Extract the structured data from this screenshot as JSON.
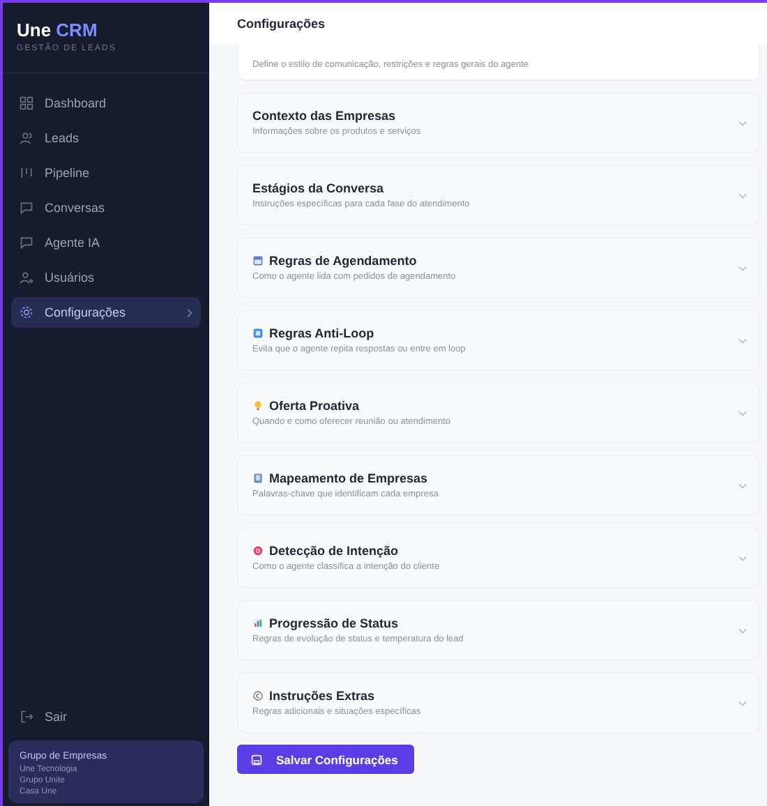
{
  "brand": {
    "name": "Une",
    "accent": "CRM",
    "tagline": "GESTÃO DE LEADS"
  },
  "nav": [
    {
      "label": "Dashboard",
      "kind": "grid",
      "selected": false
    },
    {
      "label": "Leads",
      "kind": "users",
      "selected": false
    },
    {
      "label": "Pipeline",
      "kind": "pipeline",
      "selected": false
    },
    {
      "label": "Conversas",
      "kind": "chat",
      "selected": false
    },
    {
      "label": "Agente IA",
      "kind": "chat",
      "selected": false
    },
    {
      "label": "Usuários",
      "kind": "user",
      "selected": false
    },
    {
      "label": "Configurações",
      "kind": "gear",
      "selected": true
    }
  ],
  "logout": "Sair",
  "group": {
    "title": "Grupo de Empresas",
    "companies": [
      "Une Tecnologia",
      "Grupo Unite",
      "Casa Une"
    ]
  },
  "page_title": "Configurações",
  "partial_section": {
    "description": "Define o estilo de comunicação, restrições e regras gerais do agente"
  },
  "sections": [
    {
      "title": "Contexto das Empresas",
      "description": "Informações sobre os produtos e serviços",
      "kind": "plain"
    },
    {
      "title": "Estágios da Conversa",
      "description": "Instruções específicas para cada fase do atendimento",
      "kind": "plain"
    },
    {
      "title": "Regras de Agendamento",
      "description": "Como o agente lida com pedidos de agendamento",
      "kind": "calendar"
    },
    {
      "title": "Regras Anti-Loop",
      "description": "Evita que o agente repita respostas ou entre em loop",
      "kind": "box"
    },
    {
      "title": "Oferta Proativa",
      "description": "Quando e como oferecer reunião ou atendimento",
      "kind": "bulb"
    },
    {
      "title": "Mapeamento de Empresas",
      "description": "Palavras-chave que identificam cada empresa",
      "kind": "book"
    },
    {
      "title": "Detecção de Intenção",
      "description": "Como o agente classifica a intenção do cliente",
      "kind": "target"
    },
    {
      "title": "Progressão de Status",
      "description": "Regras de evolução de status e temperatura do lead",
      "kind": "chart"
    },
    {
      "title": "Instruções Extras",
      "description": "Regras adicionais e situações específicas",
      "kind": "circle"
    }
  ],
  "save_button": "Salvar Configurações"
}
